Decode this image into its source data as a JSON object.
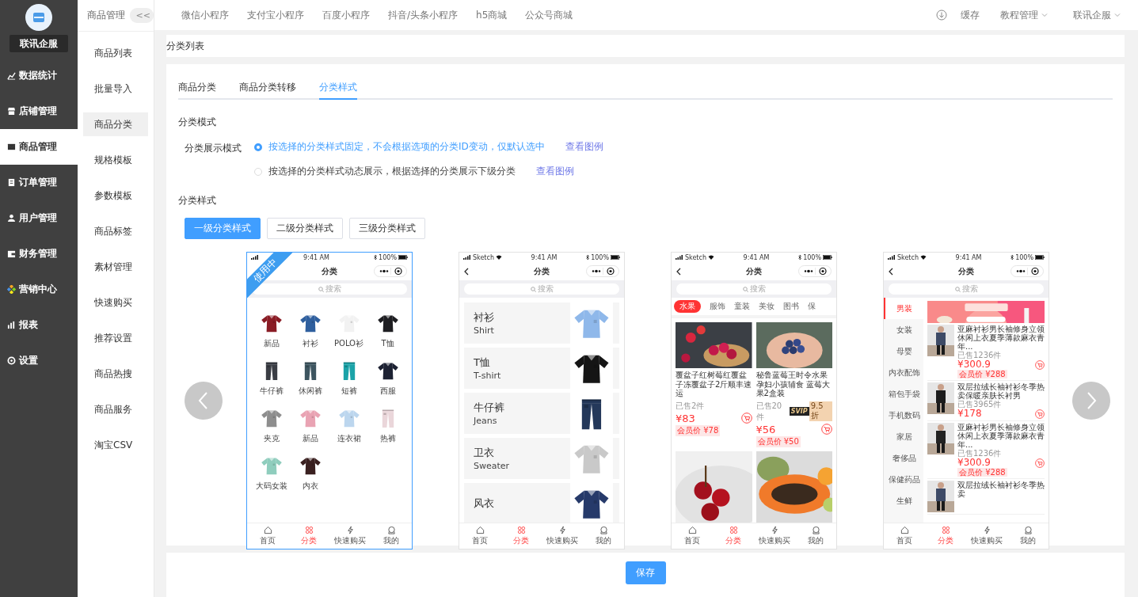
{
  "sidebar": {
    "brand": "联讯企服",
    "items": [
      {
        "label": "数据统计",
        "selected": false
      },
      {
        "label": "店铺管理",
        "selected": false
      },
      {
        "label": "商品管理",
        "selected": true
      },
      {
        "label": "订单管理",
        "selected": false
      },
      {
        "label": "用户管理",
        "selected": false
      },
      {
        "label": "财务管理",
        "selected": false
      },
      {
        "label": "营销中心",
        "selected": false
      },
      {
        "label": "报表",
        "selected": false
      },
      {
        "label": "设置",
        "selected": false
      }
    ]
  },
  "subnav": {
    "title": "商品管理",
    "collapse": "<<",
    "items": [
      {
        "label": "商品列表",
        "selected": false
      },
      {
        "label": "批量导入",
        "selected": false
      },
      {
        "label": "商品分类",
        "selected": true
      },
      {
        "label": "规格模板",
        "selected": false
      },
      {
        "label": "参数模板",
        "selected": false
      },
      {
        "label": "商品标签",
        "selected": false
      },
      {
        "label": "素材管理",
        "selected": false
      },
      {
        "label": "快速购买",
        "selected": false
      },
      {
        "label": "推荐设置",
        "selected": false
      },
      {
        "label": "商品热搜",
        "selected": false
      },
      {
        "label": "商品服务",
        "selected": false
      },
      {
        "label": "淘宝CSV",
        "selected": false
      }
    ]
  },
  "topbar": {
    "tabs": [
      "微信小程序",
      "支付宝小程序",
      "百度小程序",
      "抖音/头条小程序",
      "h5商城",
      "公众号商城"
    ],
    "cache": "缓存",
    "menus": [
      "教程管理",
      "联讯企服"
    ]
  },
  "breadcrumb": "分类列表",
  "tabs": [
    {
      "label": "商品分类",
      "selected": false
    },
    {
      "label": "商品分类转移",
      "selected": false
    },
    {
      "label": "分类样式",
      "selected": true
    }
  ],
  "mode": {
    "title": "分类模式",
    "label": "分类展示模式",
    "options": [
      {
        "text": "按选择的分类样式固定，不会根据选项的分类ID变动，仅默认选中",
        "link": "查看图例",
        "selected": true
      },
      {
        "text": "按选择的分类样式动态展示，根据选择的分类展示下级分类",
        "link": "查看图例",
        "selected": false
      }
    ]
  },
  "style": {
    "title": "分类样式",
    "levels": [
      {
        "label": "一级分类样式",
        "selected": true
      },
      {
        "label": "二级分类样式",
        "selected": false
      },
      {
        "label": "三级分类样式",
        "selected": false
      }
    ]
  },
  "previews": [
    {
      "kind": "grid",
      "selected": true,
      "badge": "使用中",
      "status": {
        "time": "9:41 AM",
        "battery": "100%"
      },
      "back": false,
      "title": "分类",
      "search": "搜索",
      "items": [
        "新品",
        "衬衫",
        "POLO衫",
        "T恤",
        "牛仔裤",
        "休闲裤",
        "短裤",
        "西服",
        "夹克",
        "新品",
        "连衣裙",
        "热裤",
        "大码女装",
        "内衣"
      ],
      "nav": [
        {
          "label": "首页",
          "selected": false
        },
        {
          "label": "分类",
          "selected": true
        },
        {
          "label": "快速购买",
          "selected": false
        },
        {
          "label": "我的",
          "selected": false
        }
      ]
    },
    {
      "kind": "rows",
      "selected": false,
      "status": {
        "carrier": "Sketch",
        "time": "9:41 AM",
        "battery": "100%"
      },
      "back": true,
      "title": "分类",
      "search": "搜索",
      "rows": [
        {
          "title": "衬衫",
          "subtitle": "Shirt"
        },
        {
          "title": "T恤",
          "subtitle": "T-shirt"
        },
        {
          "title": "牛仔裤",
          "subtitle": "Jeans"
        },
        {
          "title": "卫衣",
          "subtitle": "Sweater"
        },
        {
          "title": "风衣"
        }
      ],
      "nav": [
        {
          "label": "首页",
          "selected": false
        },
        {
          "label": "分类",
          "selected": true
        },
        {
          "label": "快速购买",
          "selected": false
        },
        {
          "label": "我的",
          "selected": false
        }
      ]
    },
    {
      "kind": "cards",
      "selected": false,
      "status": {
        "carrier": "Sketch",
        "time": "9:41 AM",
        "battery": "100%"
      },
      "back": true,
      "title": "分类",
      "search": "搜索",
      "tabs": [
        {
          "label": "水果",
          "selected": true
        },
        {
          "label": "服饰",
          "selected": false
        },
        {
          "label": "童装",
          "selected": false
        },
        {
          "label": "美妆",
          "selected": false
        },
        {
          "label": "图书",
          "selected": false
        },
        {
          "label": "保",
          "selected": false
        }
      ],
      "products": [
        {
          "kind": "product",
          "title": "覆盆子红树莓红覆盆子冻覆盆子2斤顺丰速运",
          "sold": "已售2件",
          "price": "¥83",
          "member_price": "会员价 ¥78"
        },
        {
          "kind": "product",
          "title": "秘鲁蓝莓王时令水果孕妇小孩辅食 蓝莓大果2盒装",
          "sold": "已售20件",
          "svip": "SVIP",
          "discount": "9.5折",
          "price": "¥56",
          "member_price": "会员价 ¥50"
        },
        {
          "kind": "picture"
        },
        {
          "kind": "picture"
        }
      ],
      "nav": [
        {
          "label": "首页",
          "selected": false
        },
        {
          "label": "分类",
          "selected": true
        },
        {
          "label": "快速购买",
          "selected": false
        },
        {
          "label": "我的",
          "selected": false
        }
      ]
    },
    {
      "kind": "side",
      "selected": false,
      "status": {
        "carrier": "Sketch",
        "time": "9:41 AM",
        "battery": "100%"
      },
      "back": true,
      "title": "分类",
      "search": "搜索",
      "categories": [
        {
          "label": "男装",
          "selected": true
        },
        {
          "label": "女装",
          "selected": false
        },
        {
          "label": "母婴",
          "selected": false
        },
        {
          "label": "内衣配饰",
          "selected": false
        },
        {
          "label": "箱包手袋",
          "selected": false
        },
        {
          "label": "手机数码",
          "selected": false
        },
        {
          "label": "家居",
          "selected": false
        },
        {
          "label": "奢侈品",
          "selected": false
        },
        {
          "label": "保健药品",
          "selected": false
        },
        {
          "label": "生鲜",
          "selected": false
        }
      ],
      "products": [
        {
          "title": "亚麻衬衫男长袖修身立领休闲上衣夏季薄款麻衣青年...",
          "sold": "已售1236件",
          "price": "¥300.9",
          "member_price": "会员价 ¥288"
        },
        {
          "title": "双层拉绒长袖衬衫冬季热卖保暖亲肤长衬男",
          "sold": "已售3965件",
          "price": "¥178"
        },
        {
          "title": "亚麻衬衫男长袖修身立领休闲上衣夏季薄款麻衣青年...",
          "sold": "已售1236件",
          "price": "¥300.9",
          "member_price": "会员价 ¥288"
        },
        {
          "title": "双层拉绒长袖衬衫冬季热卖"
        }
      ],
      "nav": [
        {
          "label": "首页",
          "selected": false
        },
        {
          "label": "分类",
          "selected": true
        },
        {
          "label": "快速购买",
          "selected": false
        },
        {
          "label": "我的",
          "selected": false
        }
      ]
    }
  ],
  "save": "保存"
}
